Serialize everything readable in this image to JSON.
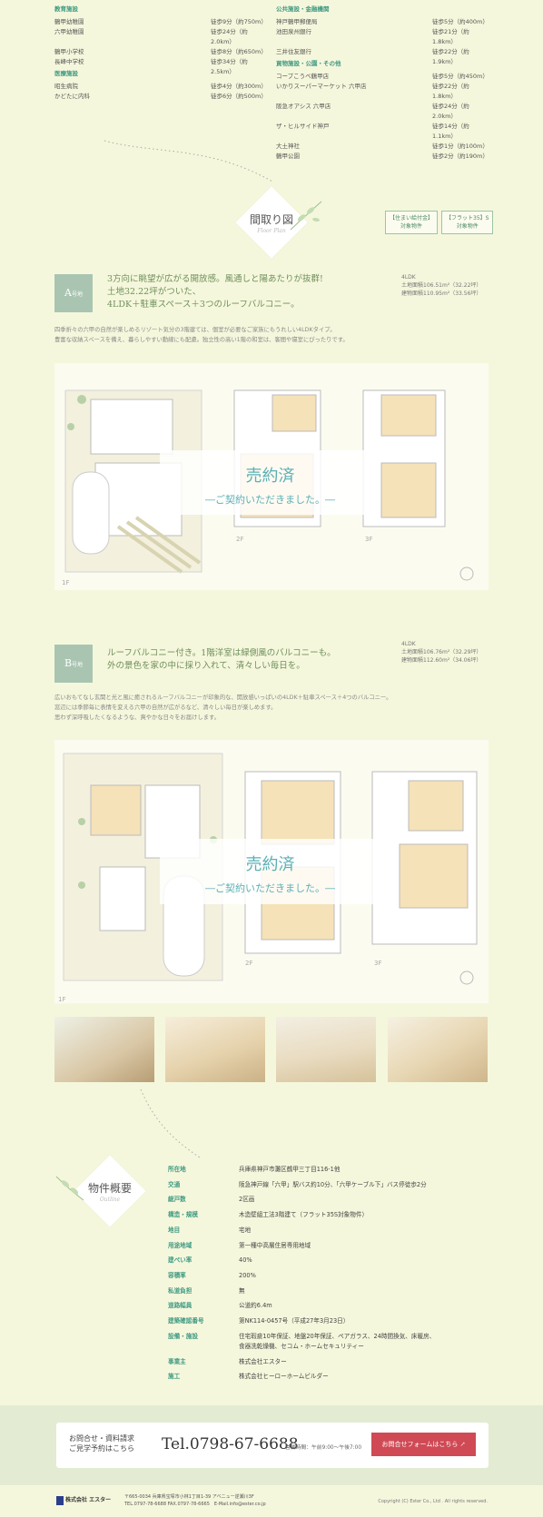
{
  "facilities": {
    "education": {
      "category": "教育施設",
      "items": [
        {
          "name": "鶴甲幼稚園",
          "dist": "徒歩9分（約750m）"
        },
        {
          "name": "六甲幼稚園",
          "dist": "徒歩24分（約2.0km）"
        },
        {
          "name": "鶴甲小学校",
          "dist": "徒歩8分（約650m）"
        },
        {
          "name": "長峰中学校",
          "dist": "徒歩34分（約2.5km）"
        }
      ]
    },
    "medical": {
      "category": "医療施設",
      "items": [
        {
          "name": "昭生病院",
          "dist": "徒歩4分（約300m）"
        },
        {
          "name": "かどたに内科",
          "dist": "徒歩6分（約500m）"
        }
      ]
    },
    "public": {
      "category": "公共施設・金融機関",
      "items": [
        {
          "name": "神戸鶴甲郵便局",
          "dist": "徒歩5分（約400m）"
        },
        {
          "name": "池田泉州銀行",
          "dist": "徒歩21分（約1.8km）"
        },
        {
          "name": "三井住友銀行",
          "dist": "徒歩22分（約1.9km）"
        }
      ]
    },
    "shopping": {
      "category": "買物施設・公園・その他",
      "items": [
        {
          "name": "コープこうべ鶴甲店",
          "dist": "徒歩5分（約450m）"
        },
        {
          "name": "いかりスーパーマーケット 六甲店",
          "dist": "徒歩22分（約1.8km）"
        },
        {
          "name": "阪急オアシス 六甲店",
          "dist": "徒歩24分（約2.0km）"
        },
        {
          "name": "ザ・ヒルサイド神戸",
          "dist": "徒歩14分（約1.1km）"
        },
        {
          "name": "大土神社",
          "dist": "徒歩1分（約100m）"
        },
        {
          "name": "鶴甲公園",
          "dist": "徒歩2分（約190m）"
        }
      ]
    }
  },
  "floorplan": {
    "title": "間取り図",
    "subtitle": "Floor Plan",
    "badge1": [
      "【住まい給付金】",
      "対象物件"
    ],
    "badge2": [
      "【フラット35】S",
      "対象物件"
    ]
  },
  "unitA": {
    "label": "A",
    "label_suffix": "号地",
    "catch": [
      "3方向に眺望が広がる開放感。風通しと陽あたりが抜群!",
      "土地32.22坪がついた、",
      "4LDK＋駐車スペース＋3つのルーフバルコニー。"
    ],
    "spec": [
      "4LDK",
      "土地面積106.51m²（32.22坪）",
      "建物面積110.95m²（33.56坪）"
    ],
    "desc": [
      "四季折々の六甲の自然が楽しめるリゾート気分の3階建ては、個室が必要なご家族にもうれしい4LDKタイプ。",
      "豊富な収納スペースを備え、暮らしやすい動線にも配慮。独立性の高い1階の和室は、客間や寝室にぴったりです。"
    ],
    "sold": "売約済",
    "sold_sub": "―ご契約いただきました。―",
    "floors": [
      "1F",
      "2F",
      "3F"
    ]
  },
  "unitB": {
    "label": "B",
    "label_suffix": "号地",
    "catch": [
      "ルーフバルコニー付き。1階洋室は緑側風のバルコニーも。",
      "外の景色を家の中に採り入れて、清々しい毎日を。"
    ],
    "spec": [
      "4LDK",
      "土地面積106.76m²（32.29坪）",
      "建物面積112.60m²（34.06坪）"
    ],
    "desc": [
      "広いおもてなし玄関と光と風に癒されるルーフバルコニーが印象的な、開放感いっぱいの4LDK＋駐車スペース＋4つのバルコニー。",
      "窓辺には季節毎に表情を変える六甲の自然が広がるなど、清々しい毎日が楽しめます。",
      "思わず深呼吸したくなるような、爽やかな日々をお届けします。"
    ],
    "sold": "売約済",
    "sold_sub": "―ご契約いただきました。―",
    "floors": [
      "1F",
      "2F",
      "3F"
    ]
  },
  "overview": {
    "title": "物件概要",
    "subtitle": "Outline",
    "rows": [
      {
        "k": "所在地",
        "v": "兵庫県神戸市灘区鶴甲三丁目116-1他"
      },
      {
        "k": "交通",
        "v": "阪急神戸線「六甲」駅バス約10分、「六甲ケーブル下」バス停徒歩2分"
      },
      {
        "k": "総戸数",
        "v": "2区画"
      },
      {
        "k": "構造・規模",
        "v": "木造壁組工法3階建て（フラット35S対象物件）"
      },
      {
        "k": "地目",
        "v": "宅地"
      },
      {
        "k": "用途地域",
        "v": "第一種中高層住居専用地域"
      },
      {
        "k": "建ぺい率",
        "v": "40%"
      },
      {
        "k": "容積率",
        "v": "200%"
      },
      {
        "k": "私道負担",
        "v": "無"
      },
      {
        "k": "道路幅員",
        "v": "公道約6.4m"
      },
      {
        "k": "建築確認番号",
        "v": "第NK114-0457号（平成27年3月23日）"
      },
      {
        "k": "設備・施設",
        "v": "住宅瑕疵10年保証、地盤20年保証、ペアガラス、24時間換気、床暖房、",
        "v2": "食器洗乾燥機、セコム・ホームセキュリティー"
      },
      {
        "k": "事業主",
        "v": "株式会社エスター"
      },
      {
        "k": "施工",
        "v": "株式会社ヒーローホームビルダー"
      }
    ]
  },
  "contact": {
    "lead1": "お問合せ・資料請求",
    "lead2": "ご見学予約はこちら",
    "tel": "Tel.0798-67-6688",
    "hours": "営業時間：午前9:00〜午後7:00",
    "button": "お問合せフォームはこちら"
  },
  "footer": {
    "company": "株式会社 エスター",
    "address": "〒665-0034 兵庫県宝塚市小林1丁目1-39 アベニュー逆瀬川3F",
    "tel": "TEL.0797-78-6688 FAX.0797-78-6665　E-Mail.info@ester.co.jp",
    "copyright": "Copyright (C) Ester Co., Ltd . All rights reserved."
  }
}
